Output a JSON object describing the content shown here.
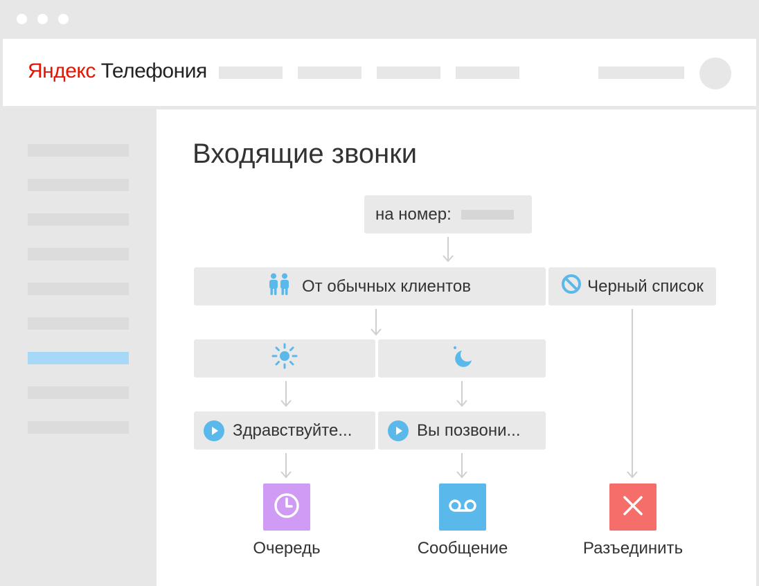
{
  "app": {
    "brand": "Яндекс",
    "product": "Телефония"
  },
  "page": {
    "title": "Входящие звонки"
  },
  "flow": {
    "number_node_label": "на номер:",
    "regular_clients_label": "От обычных клиентов",
    "blacklist_label": "Черный список",
    "day_greeting": "Здравствуйте...",
    "night_greeting": "Вы позвони...",
    "actions": {
      "queue": "Очередь",
      "message": "Сообщение",
      "disconnect": "Разъединить"
    }
  },
  "colors": {
    "accent_blue": "#5ab8ea",
    "queue_purple": "#d09bf5",
    "message_blue": "#5ab8ea",
    "disconnect_red": "#f56e6a",
    "brand_red": "#e61400",
    "sidebar_active": "#a8d8f7"
  },
  "icons": {
    "regular_clients": "people-icon",
    "blacklist": "no-entry-icon",
    "day": "sun-icon",
    "night": "moon-icon",
    "greeting": "play-icon",
    "queue": "clock-icon",
    "message": "voicemail-icon",
    "disconnect": "close-icon"
  }
}
